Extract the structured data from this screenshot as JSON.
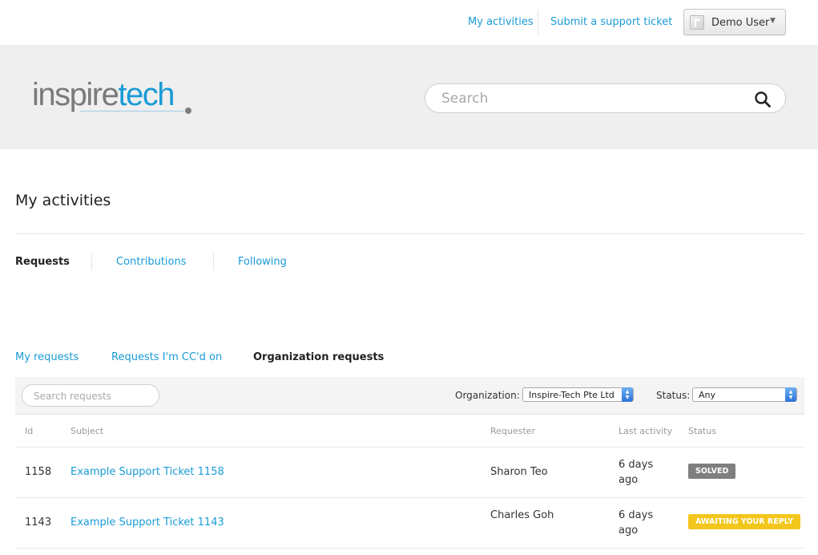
{
  "topnav": {
    "my_activities": "My activities",
    "submit_ticket": "Submit a support ticket",
    "user_name": "Demo User",
    "user_caret": "▼"
  },
  "hero": {
    "logo_part1": "inspire",
    "logo_part2": "tech",
    "search_placeholder": "Search"
  },
  "page": {
    "title": "My activities"
  },
  "subnav": {
    "requests": "Requests",
    "contributions": "Contributions",
    "following": "Following"
  },
  "filter_tabs": {
    "my_requests": "My requests",
    "ccd": "Requests I'm CC'd on",
    "org": "Organization requests"
  },
  "toolbar": {
    "search_placeholder": "Search requests",
    "org_label": "Organization:",
    "org_value": "Inspire-Tech Pte Ltd",
    "status_label": "Status:",
    "status_value": "Any"
  },
  "table": {
    "headers": {
      "id": "Id",
      "subject": "Subject",
      "requester": "Requester",
      "last_activity": "Last activity",
      "status": "Status"
    },
    "rows": [
      {
        "id": "1158",
        "subject": "Example Support Ticket 1158",
        "requester": "Sharon Teo",
        "last_activity": "6 days ago",
        "status": "Solved"
      },
      {
        "id": "1143",
        "subject": "Example Support Ticket 1143",
        "requester": "Charles Goh",
        "last_activity": "6 days ago",
        "status": "Awaiting your reply"
      }
    ]
  },
  "colors": {
    "accent": "#1a9bd7",
    "solved": "#7f7f7f",
    "awaiting": "#f3c61c"
  }
}
